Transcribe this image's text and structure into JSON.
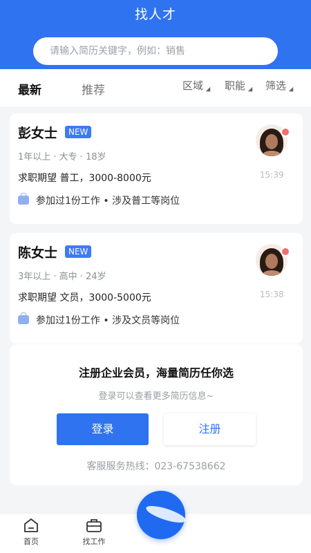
{
  "header": {
    "title": "找人才"
  },
  "search": {
    "placeholder": "请输入简历关键字，例如：销售"
  },
  "tabs": {
    "latest": "最新",
    "recommend": "推荐"
  },
  "filters": [
    "区域",
    "职能",
    "筛选"
  ],
  "resumes": [
    {
      "name": "彭女士",
      "badge": "NEW",
      "meta": "1年以上 · 大专 · 18岁",
      "expect": "求职期望 普工，3000-8000元",
      "experience": "参加过1份工作 • 涉及普工等岗位",
      "time": "15:39"
    },
    {
      "name": "陈女士",
      "badge": "NEW",
      "meta": "3年以上 · 高中 · 24岁",
      "expect": "求职期望 文员，3000-5000元",
      "experience": "参加过1份工作 • 涉及文员等岗位",
      "time": "15:38"
    }
  ],
  "promo": {
    "title": "注册企业会员，海量简历任你选",
    "subtitle": "登录可以查看更多简历信息~",
    "login": "登录",
    "register": "注册",
    "hotline": "客服服务热线：023-67538662"
  },
  "tabbar": {
    "home": "首页",
    "find_job": "找工作"
  },
  "colors": {
    "brand": "#2f73f0",
    "badge": "#3d7af5",
    "dot": "#f06f6f"
  }
}
